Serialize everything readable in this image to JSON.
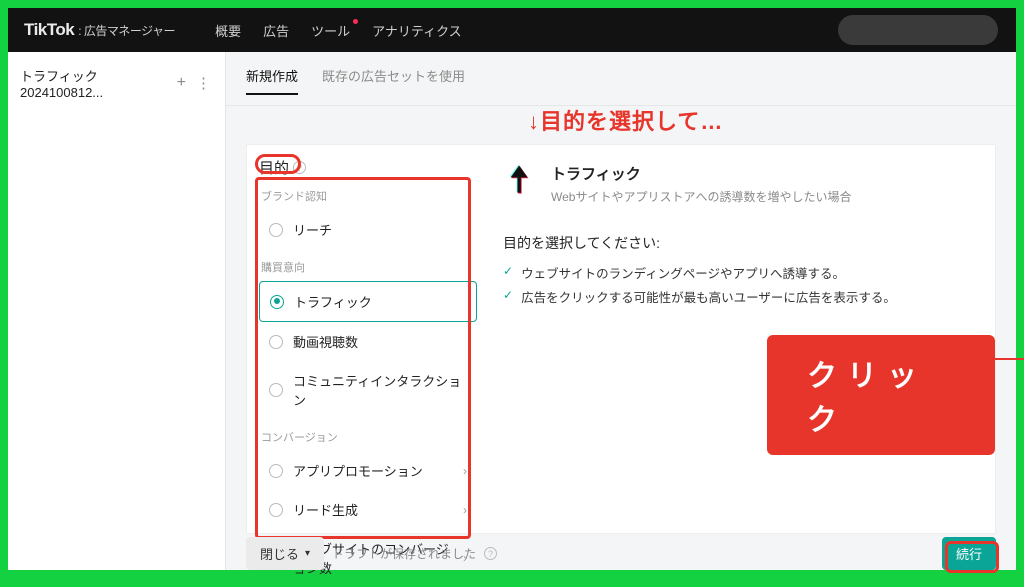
{
  "header": {
    "logo": "TikTok",
    "logo_sub": ": 広告マネージャー",
    "nav": [
      "概要",
      "広告",
      "ツール",
      "アナリティクス"
    ]
  },
  "sidebar": {
    "campaign_name": "トラフィック 2024100812..."
  },
  "tabs": {
    "new": "新規作成",
    "existing": "既存の広告セットを使用"
  },
  "annotations": {
    "select_objective": "↓目的を選択して…",
    "click": "クリック"
  },
  "objective": {
    "title": "目的",
    "groups": [
      {
        "label": "ブランド認知",
        "options": [
          {
            "label": "リーチ",
            "selected": false,
            "expandable": false
          }
        ]
      },
      {
        "label": "購買意向",
        "options": [
          {
            "label": "トラフィック",
            "selected": true,
            "expandable": false
          },
          {
            "label": "動画視聴数",
            "selected": false,
            "expandable": false
          },
          {
            "label": "コミュニティインタラクション",
            "selected": false,
            "expandable": false
          }
        ]
      },
      {
        "label": "コンバージョン",
        "options": [
          {
            "label": "アプリプロモーション",
            "selected": false,
            "expandable": true
          },
          {
            "label": "リード生成",
            "selected": false,
            "expandable": true
          },
          {
            "label": "ウェブサイトのコンバージョン数",
            "selected": false,
            "expandable": true
          }
        ]
      }
    ]
  },
  "detail": {
    "title": "トラフィック",
    "subtitle": "Webサイトやアプリストアへの誘導数を増やしたい場合",
    "prompt": "目的を選択してください:",
    "bullets": [
      "ウェブサイトのランディングページやアプリへ誘導する。",
      "広告をクリックする可能性が最も高いユーザーに広告を表示する。"
    ]
  },
  "footer": {
    "close": "閉じる",
    "draft_saved": "ドラフトが保存されました",
    "continue": "続行"
  },
  "colors": {
    "accent_teal": "#0aa596",
    "brand_red": "#fe2c55",
    "annotation_red": "#e7352c",
    "frame_green": "#14d142"
  }
}
